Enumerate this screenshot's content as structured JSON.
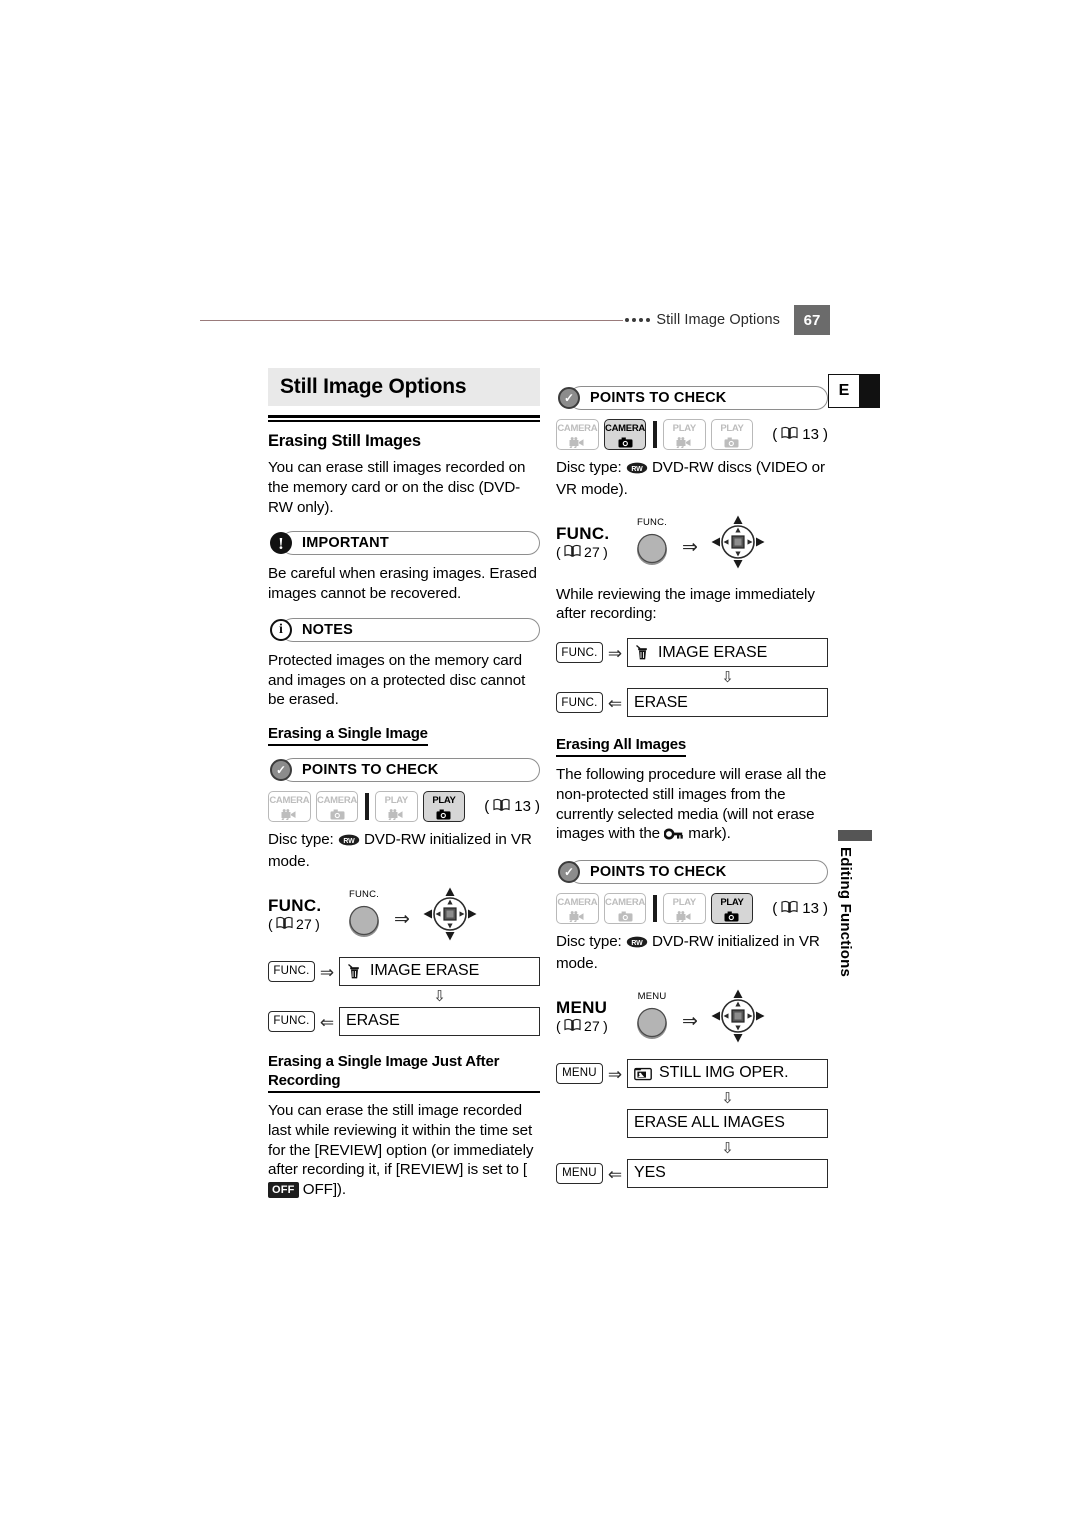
{
  "header": {
    "title": "Still Image Options",
    "page_number": "67",
    "dots": 4
  },
  "edge": {
    "letter": "E",
    "vertical_tab": "Editing Functions"
  },
  "chapter": {
    "title": "Still Image Options"
  },
  "labels": {
    "important": "IMPORTANT",
    "notes": "NOTES",
    "points_to_check": "POINTS TO CHECK",
    "func": "FUNC.",
    "menu": "MENU",
    "func_hw": "FUNC.",
    "menu_hw": "MENU"
  },
  "icons": {
    "book": "book-icon",
    "disc_rw": "dvd-rw-disc-icon",
    "camera_movie": "movie-camera-icon",
    "camera_still": "still-camera-icon",
    "trash": "trash-can-icon",
    "folder_image": "still-image-folder-icon",
    "key": "protect-key-icon",
    "joystick": "joystick-icon"
  },
  "left": {
    "section_heading": "Erasing Still Images",
    "intro": "You can erase still images recorded on the memory card or on the disc (DVD-RW only).",
    "important_text": "Be careful when erasing images. Erased images cannot be recovered.",
    "notes_text": "Protected images on the memory card and images on a protected disc cannot be erased.",
    "single": {
      "heading": "Erasing a Single Image",
      "modes": [
        {
          "label": "CAMERA",
          "icon": "movie-camera-icon",
          "active": false
        },
        {
          "label": "CAMERA",
          "icon": "still-camera-icon",
          "active": false
        },
        {
          "label": "PLAY",
          "icon": "movie-camera-icon",
          "active": false
        },
        {
          "label": "PLAY",
          "icon": "still-camera-icon",
          "active": true
        }
      ],
      "mode_ref": "13",
      "disc_type": "Disc type:",
      "disc_text": "DVD-RW initialized in VR mode.",
      "op_key": "FUNC.",
      "op_ref": "27",
      "hw_label": "FUNC.",
      "flow": [
        {
          "key": "FUNC.",
          "arrow": "right",
          "icon": "trash-can-icon",
          "text": "IMAGE ERASE"
        },
        {
          "key": "FUNC.",
          "arrow": "left",
          "icon": null,
          "text": "ERASE"
        }
      ]
    },
    "just_after": {
      "heading": "Erasing a Single Image Just After Recording",
      "text_1": "You can erase the still image recorded last while reviewing it within the time set for the [REVIEW] option (or immediately after recording it, if [REVIEW] is set to [",
      "off_chip": "OFF",
      "off_word": "OFF",
      "text_2": "]).",
      "full_text": "You can erase the still image recorded last while reviewing it within the time set for the [REVIEW] option (or immediately after recording it, if [REVIEW] is set to [OFF OFF])."
    }
  },
  "right": {
    "points_1": {
      "modes": [
        {
          "label": "CAMERA",
          "icon": "movie-camera-icon",
          "active": false
        },
        {
          "label": "CAMERA",
          "icon": "still-camera-icon",
          "active": true
        },
        {
          "label": "PLAY",
          "icon": "movie-camera-icon",
          "active": false
        },
        {
          "label": "PLAY",
          "icon": "still-camera-icon",
          "active": false
        }
      ],
      "mode_ref": "13",
      "disc_type": "Disc type:",
      "disc_text": "DVD-RW discs (VIDEO or VR mode).",
      "op_key": "FUNC.",
      "op_ref": "27",
      "hw_label": "FUNC.",
      "lead_in": "While reviewing the image immediately after recording:",
      "flow": [
        {
          "key": "FUNC.",
          "arrow": "right",
          "icon": "trash-can-icon",
          "text": "IMAGE ERASE"
        },
        {
          "key": "FUNC.",
          "arrow": "left",
          "icon": null,
          "text": "ERASE"
        }
      ]
    },
    "all": {
      "heading": "Erasing All Images",
      "text_1": "The following procedure will erase all the non-protected still images from the currently selected media (will not erase images with the",
      "text_2": "mark).",
      "modes": [
        {
          "label": "CAMERA",
          "icon": "movie-camera-icon",
          "active": false
        },
        {
          "label": "CAMERA",
          "icon": "still-camera-icon",
          "active": false
        },
        {
          "label": "PLAY",
          "icon": "movie-camera-icon",
          "active": false
        },
        {
          "label": "PLAY",
          "icon": "still-camera-icon",
          "active": true
        }
      ],
      "mode_ref": "13",
      "disc_type": "Disc type:",
      "disc_text": "DVD-RW initialized in VR mode.",
      "op_key": "MENU",
      "op_ref": "27",
      "hw_label": "MENU",
      "flow": [
        {
          "key": "MENU",
          "arrow": "right",
          "icon": "still-image-folder-icon",
          "text": "STILL IMG OPER."
        },
        {
          "key": "",
          "arrow": "none",
          "icon": null,
          "text": "ERASE ALL IMAGES"
        },
        {
          "key": "MENU",
          "arrow": "left",
          "icon": null,
          "text": "YES"
        }
      ]
    }
  },
  "colors": {
    "rule": "#9a7b7b",
    "page_badge": "#6b6b6b",
    "band": "#e9e9e9",
    "active_mode": "#d6d6d6"
  }
}
